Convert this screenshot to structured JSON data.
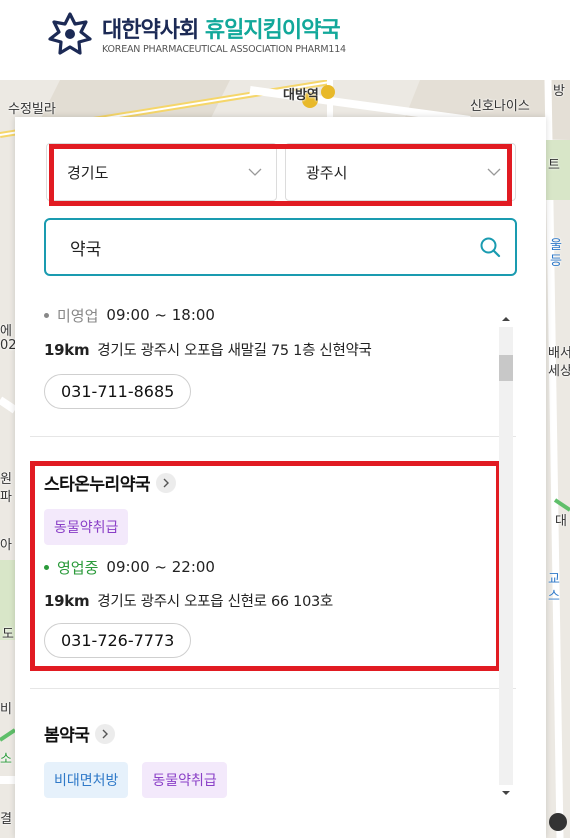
{
  "header": {
    "title_part1": "대한약사회",
    "title_part2": "휴일지킴이약국",
    "subtitle": "KOREAN PHARMACEUTICAL ASSOCIATION PHARM114"
  },
  "map": {
    "labels": {
      "top_left": "수정빌라",
      "station": "대방역",
      "top_right_1": "신호나이스",
      "top_right_2": "방",
      "right_1": "트",
      "right_2": "울",
      "right_3": "등",
      "right_4": "배서",
      "right_5": "세상",
      "right_6": "대",
      "right_7": "교",
      "right_8": "스",
      "left_1": "에",
      "left_2": "02",
      "left_3": "원",
      "left_4": "파",
      "left_5": "아",
      "left_6": "도",
      "left_7": "비",
      "left_8": "소",
      "left_9": "결"
    }
  },
  "filters": {
    "region": "경기도",
    "city": "광주시"
  },
  "search": {
    "value": "약국"
  },
  "list": {
    "items": [
      {
        "status": "미영업",
        "hours": "09:00 ~ 18:00",
        "distance": "19km",
        "address": "경기도 광주시 오포읍 새말길 75 1층 신현약국",
        "phone": "031-711-8685"
      },
      {
        "name": "스타온누리약국",
        "tags": [
          "동물약취급"
        ],
        "status": "영업중",
        "hours": "09:00 ~ 22:00",
        "distance": "19km",
        "address": "경기도 광주시 오포읍 신현로 66 103호",
        "phone": "031-726-7773"
      },
      {
        "name": "봄약국",
        "tags": [
          "비대면처방",
          "동물약취급"
        ]
      }
    ]
  },
  "colors": {
    "accent": "#1a9bb0",
    "highlight_frame": "#e11b22",
    "open_status": "#2a9a3a",
    "brand_navy": "#1c2a55",
    "brand_green": "#12a89a"
  }
}
